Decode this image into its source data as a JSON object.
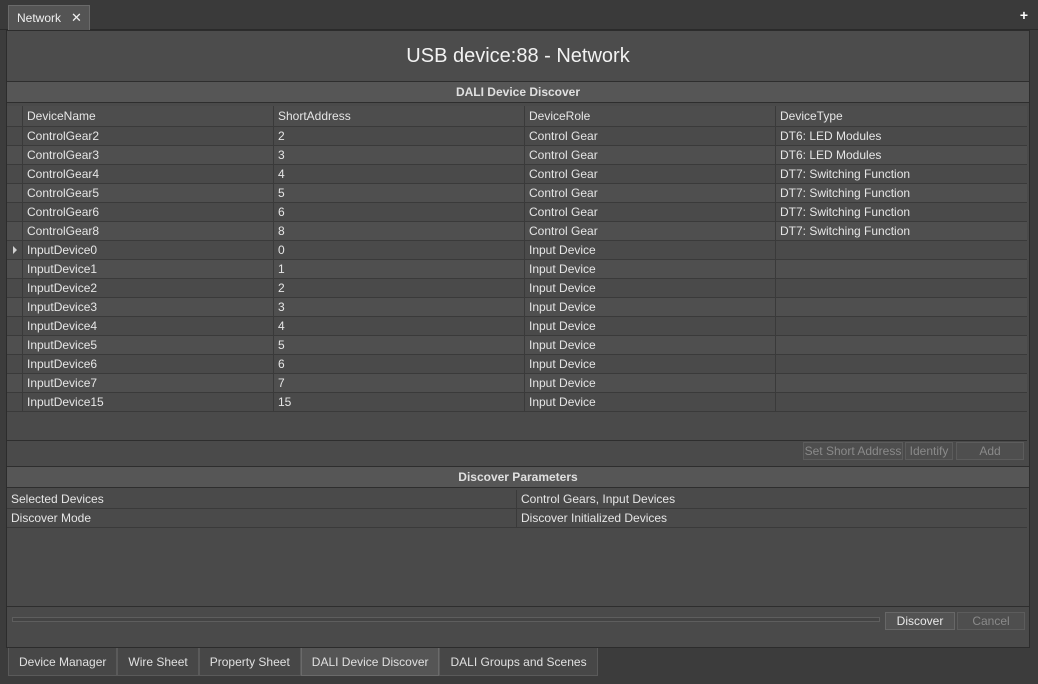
{
  "document_tab": {
    "label": "Network",
    "close_glyph": "✕"
  },
  "add_tab_glyph": "+",
  "page_title": "USB device:88 - Network",
  "discover_section": {
    "title": "DALI Device Discover",
    "columns": [
      "DeviceName",
      "ShortAddress",
      "DeviceRole",
      "DeviceType"
    ],
    "rows": [
      {
        "name": "ControlGear2",
        "address": "2",
        "role": "Control Gear",
        "type": "DT6: LED Modules"
      },
      {
        "name": "ControlGear3",
        "address": "3",
        "role": "Control Gear",
        "type": "DT6: LED Modules"
      },
      {
        "name": "ControlGear4",
        "address": "4",
        "role": "Control Gear",
        "type": "DT7: Switching Function"
      },
      {
        "name": "ControlGear5",
        "address": "5",
        "role": "Control Gear",
        "type": "DT7: Switching Function"
      },
      {
        "name": "ControlGear6",
        "address": "6",
        "role": "Control Gear",
        "type": "DT7: Switching Function"
      },
      {
        "name": "ControlGear8",
        "address": "8",
        "role": "Control Gear",
        "type": "DT7: Switching Function"
      },
      {
        "name": "InputDevice0",
        "address": "0",
        "role": "Input Device",
        "type": "",
        "selected": true
      },
      {
        "name": "InputDevice1",
        "address": "1",
        "role": "Input Device",
        "type": ""
      },
      {
        "name": "InputDevice2",
        "address": "2",
        "role": "Input Device",
        "type": ""
      },
      {
        "name": "InputDevice3",
        "address": "3",
        "role": "Input Device",
        "type": ""
      },
      {
        "name": "InputDevice4",
        "address": "4",
        "role": "Input Device",
        "type": ""
      },
      {
        "name": "InputDevice5",
        "address": "5",
        "role": "Input Device",
        "type": ""
      },
      {
        "name": "InputDevice6",
        "address": "6",
        "role": "Input Device",
        "type": ""
      },
      {
        "name": "InputDevice7",
        "address": "7",
        "role": "Input Device",
        "type": ""
      },
      {
        "name": "InputDevice15",
        "address": "15",
        "role": "Input Device",
        "type": ""
      }
    ]
  },
  "grid_actions": {
    "set_short_address": "Set Short Address",
    "identify": "Identify",
    "add": "Add"
  },
  "parameters_section": {
    "title": "Discover Parameters",
    "rows": [
      {
        "label": "Selected Devices",
        "value": "Control Gears,  Input Devices"
      },
      {
        "label": "Discover Mode",
        "value": "Discover Initialized Devices"
      }
    ]
  },
  "discover_controls": {
    "discover": "Discover",
    "cancel": "Cancel",
    "progress_fraction": 0.0
  },
  "view_tabs": [
    {
      "label": "Device Manager"
    },
    {
      "label": "Wire Sheet"
    },
    {
      "label": "Property Sheet"
    },
    {
      "label": "DALI Device Discover",
      "active": true
    },
    {
      "label": "DALI Groups and Scenes"
    }
  ]
}
